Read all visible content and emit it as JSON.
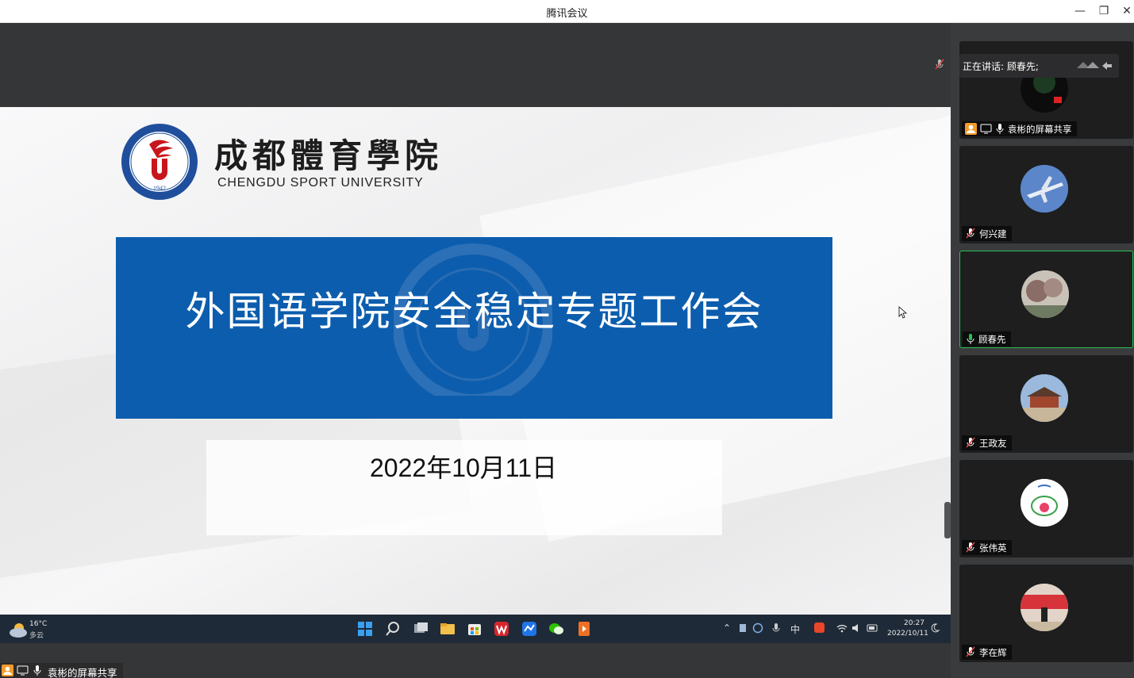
{
  "window": {
    "title": "腾讯会议"
  },
  "slide": {
    "university_cn": "成都體育學院",
    "university_en": "CHENGDU SPORT UNIVERSITY",
    "logo_year": "1942",
    "title": "外国语学院安全稳定专题工作会",
    "date": "2022年10月11日"
  },
  "taskbar": {
    "temperature": "16°C",
    "weather": "多云",
    "ime": "中",
    "time": "20:27",
    "date": "2022/10/11"
  },
  "share_label": "袁彬的屏幕共享",
  "speaking": {
    "label": "正在讲话: 顾春先;"
  },
  "participants": [
    {
      "name": "袁彬的屏幕共享",
      "mic": "on",
      "sharing": true
    },
    {
      "name": "何兴建",
      "mic": "muted"
    },
    {
      "name": "顾春先",
      "mic": "active",
      "active": true
    },
    {
      "name": "王政友",
      "mic": "muted"
    },
    {
      "name": "张伟英",
      "mic": "muted"
    },
    {
      "name": "李在辉",
      "mic": "muted"
    }
  ],
  "colors": {
    "banner": "#0c5dad",
    "active_speaker": "#27c253",
    "logo_red": "#c8161d",
    "logo_blue": "#1f4f9c"
  }
}
